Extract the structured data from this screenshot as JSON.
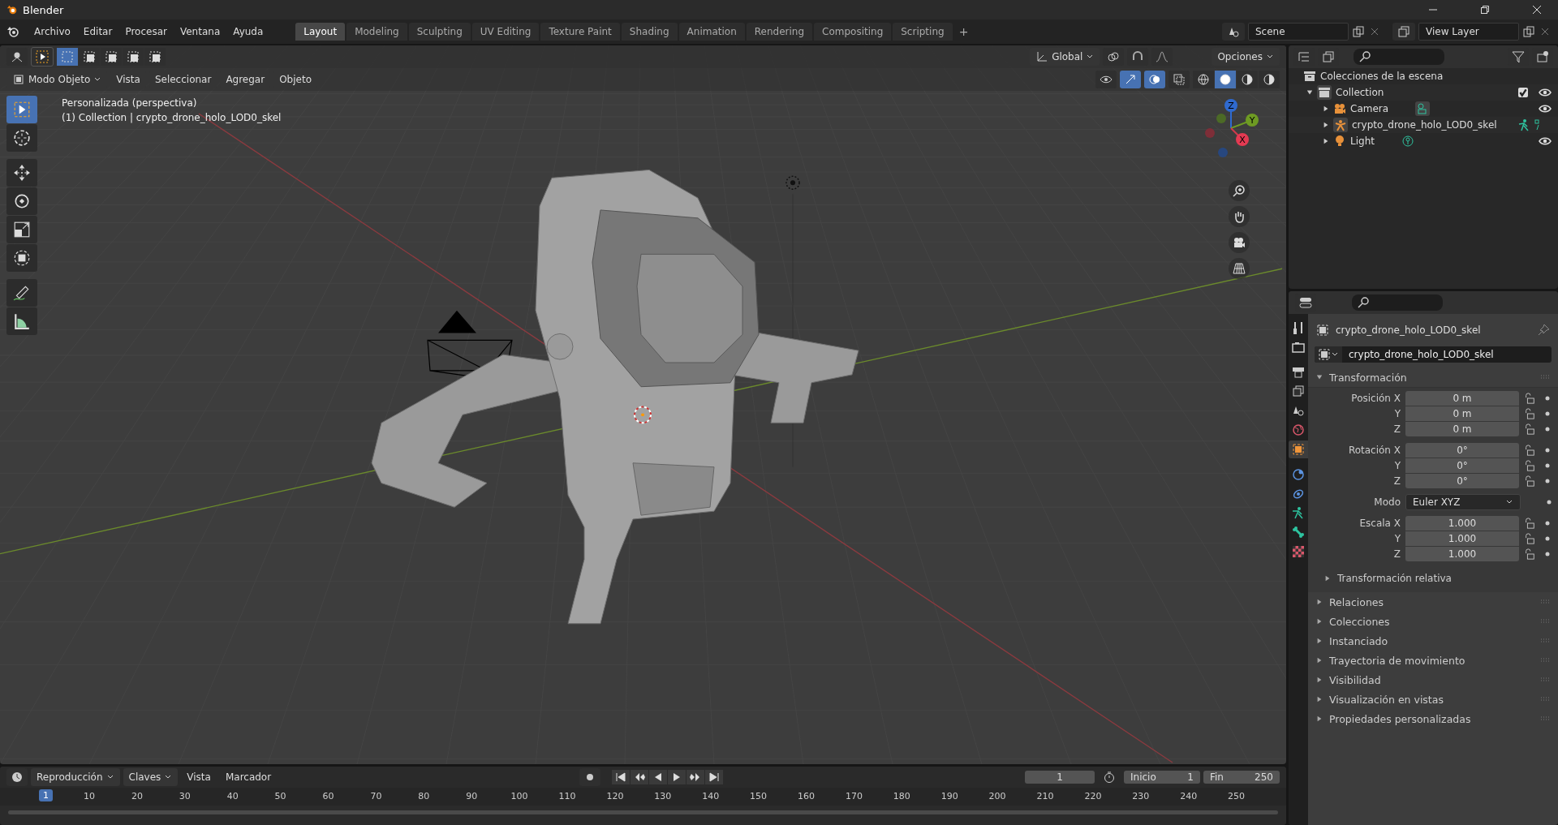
{
  "window": {
    "title": "Blender"
  },
  "menu": [
    "Archivo",
    "Editar",
    "Procesar",
    "Ventana",
    "Ayuda"
  ],
  "workspaces": [
    {
      "label": "Layout",
      "selected": true
    },
    {
      "label": "Modeling",
      "selected": false
    },
    {
      "label": "Sculpting",
      "selected": false
    },
    {
      "label": "UV Editing",
      "selected": false
    },
    {
      "label": "Texture Paint",
      "selected": false
    },
    {
      "label": "Shading",
      "selected": false
    },
    {
      "label": "Animation",
      "selected": false
    },
    {
      "label": "Rendering",
      "selected": false
    },
    {
      "label": "Compositing",
      "selected": false
    },
    {
      "label": "Scripting",
      "selected": false
    }
  ],
  "add_workspace": "+",
  "scene": {
    "value": "Scene"
  },
  "view_layer": {
    "value": "View Layer"
  },
  "viewport": {
    "select_modes": [
      {
        "selected": true
      },
      {
        "selected": false
      },
      {
        "selected": false
      },
      {
        "selected": false
      },
      {
        "selected": false
      }
    ],
    "orientation": "Global",
    "options": "Opciones",
    "mode": "Modo Objeto",
    "menus": [
      "Vista",
      "Seleccionar",
      "Agregar",
      "Objeto"
    ],
    "overlay_text": [
      "Personalizada (perspectiva)",
      "(1) Collection | crypto_drone_holo_LOD0_skel"
    ],
    "tools": [
      {
        "kind": "select",
        "selected": true
      },
      {
        "kind": "cursor",
        "selected": false
      },
      {
        "kind": "move",
        "selected": false
      },
      {
        "kind": "rotate",
        "selected": false
      },
      {
        "kind": "scale",
        "selected": false
      },
      {
        "kind": "transform",
        "selected": false
      },
      {
        "kind": "annotate",
        "selected": false
      },
      {
        "kind": "measure",
        "selected": false
      }
    ],
    "shading_modes": [
      {
        "selected": false
      },
      {
        "selected": true
      },
      {
        "selected": false
      },
      {
        "selected": false
      }
    ],
    "gizmo_axes": [
      "Z",
      "Y",
      "X"
    ]
  },
  "outliner": {
    "root": "Colecciones de la escena",
    "items": [
      {
        "name": "Collection",
        "kind": "collection",
        "expanded": true,
        "checked": true,
        "children": [
          {
            "name": "Camera",
            "kind": "camera",
            "expanded": false
          },
          {
            "name": "crypto_drone_holo_LOD0_skel",
            "kind": "armature",
            "expanded": false
          },
          {
            "name": "Light",
            "kind": "light",
            "expanded": false
          }
        ]
      }
    ]
  },
  "properties": {
    "tabs": [
      {
        "kind": "tool",
        "selected": false
      },
      {
        "kind": "render",
        "selected": false
      },
      {
        "kind": "output",
        "selected": false
      },
      {
        "kind": "view_layer",
        "selected": false
      },
      {
        "kind": "scene",
        "selected": false
      },
      {
        "kind": "world",
        "selected": false
      },
      {
        "kind": "object",
        "selected": true
      },
      {
        "kind": "modifiers",
        "selected": false
      },
      {
        "kind": "physics",
        "selected": false
      },
      {
        "kind": "armature",
        "selected": false
      },
      {
        "kind": "bone",
        "selected": false
      },
      {
        "kind": "texture",
        "selected": false
      }
    ],
    "object_name": "crypto_drone_holo_LOD0_skel",
    "data_name": "crypto_drone_holo_LOD0_skel",
    "transform": {
      "title": "Transformación",
      "expanded": true,
      "groups": [
        {
          "rows": [
            {
              "label": "Posición X",
              "value": "0 m",
              "kind": "number"
            },
            {
              "label": "Y",
              "value": "0 m",
              "kind": "number"
            },
            {
              "label": "Z",
              "value": "0 m",
              "kind": "number"
            }
          ]
        },
        {
          "rows": [
            {
              "label": "Rotación X",
              "value": "0°",
              "kind": "number"
            },
            {
              "label": "Y",
              "value": "0°",
              "kind": "number"
            },
            {
              "label": "Z",
              "value": "0°",
              "kind": "number"
            }
          ]
        },
        {
          "rows": [
            {
              "label": "Modo",
              "value": "Euler XYZ",
              "kind": "dropdown"
            }
          ]
        },
        {
          "rows": [
            {
              "label": "Escala X",
              "value": "1.000",
              "kind": "number"
            },
            {
              "label": "Y",
              "value": "1.000",
              "kind": "number"
            },
            {
              "label": "Z",
              "value": "1.000",
              "kind": "number"
            }
          ]
        }
      ],
      "subpanel": {
        "title": "Transformación relativa",
        "expanded": false
      }
    },
    "panels": [
      {
        "title": "Relaciones",
        "expanded": false
      },
      {
        "title": "Colecciones",
        "expanded": false
      },
      {
        "title": "Instanciado",
        "expanded": false
      },
      {
        "title": "Trayectoria de movimiento",
        "expanded": false
      },
      {
        "title": "Visibilidad",
        "expanded": false
      },
      {
        "title": "Visualización en vistas",
        "expanded": false
      },
      {
        "title": "Propiedades personalizadas",
        "expanded": false
      }
    ]
  },
  "timeline": {
    "menus": [
      {
        "label": "Reproducción",
        "dropdown": true
      },
      {
        "label": "Claves",
        "dropdown": true
      },
      {
        "label": "Vista",
        "dropdown": false
      },
      {
        "label": "Marcador",
        "dropdown": false
      }
    ],
    "current_frame": "1",
    "start": {
      "label": "Inicio",
      "value": "1"
    },
    "end": {
      "label": "Fin",
      "value": "250"
    },
    "playhead": "1",
    "ruler": [
      "10",
      "20",
      "30",
      "40",
      "50",
      "60",
      "70",
      "80",
      "90",
      "100",
      "110",
      "120",
      "130",
      "140",
      "150",
      "160",
      "170",
      "180",
      "190",
      "200",
      "210",
      "220",
      "230",
      "240",
      "250"
    ]
  }
}
